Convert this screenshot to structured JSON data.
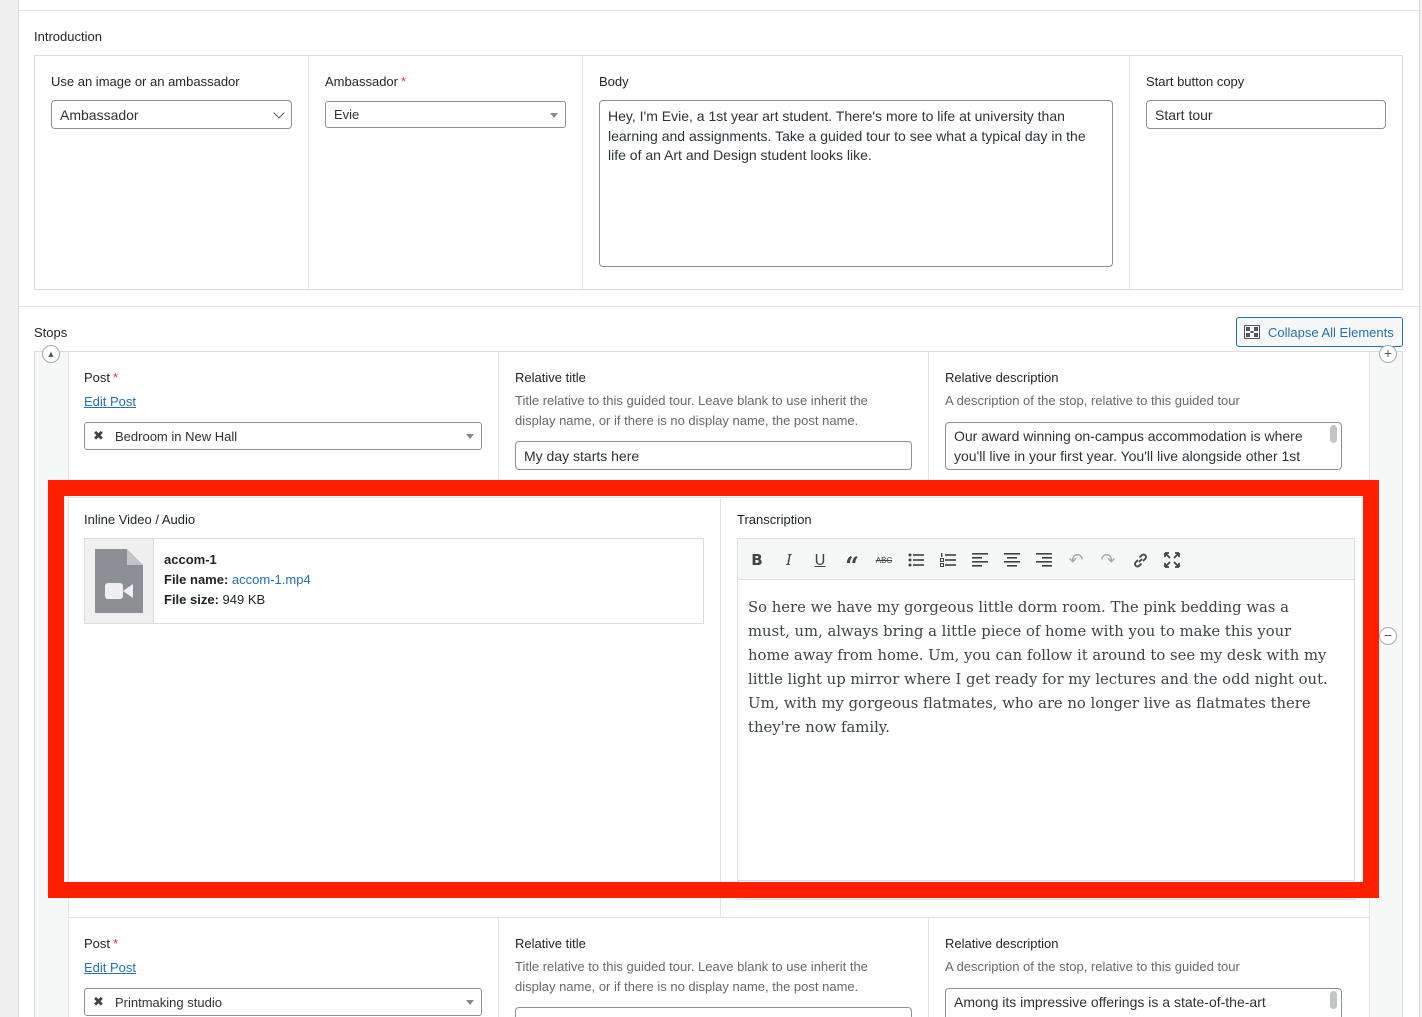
{
  "introduction": {
    "section_label": "Introduction",
    "image_or_ambassador": {
      "label": "Use an image or an ambassador",
      "value": "Ambassador"
    },
    "ambassador": {
      "label": "Ambassador",
      "required": "*",
      "value": "Evie"
    },
    "body": {
      "label": "Body",
      "value": "Hey, I'm Evie, a 1st year art student. There's more to life at university than learning and assignments. Take a guided tour to see what a typical day in the life of an Art and Design student looks like."
    },
    "start_button": {
      "label": "Start button copy",
      "value": "Start tour"
    }
  },
  "stops": {
    "section_label": "Stops",
    "collapse_button": "Collapse All Elements",
    "items": [
      {
        "post_label": "Post",
        "required": "*",
        "edit_link": "Edit Post",
        "post_value": "Bedroom in New Hall",
        "relative_title_label": "Relative title",
        "relative_title_help": "Title relative to this guided tour. Leave blank to use inherit the display name, or if there is no display name, the post name.",
        "relative_title_value": "My day starts here",
        "relative_description_label": "Relative description",
        "relative_description_help": "A description of the stop, relative to this guided tour",
        "relative_description_value": "Our award winning on-campus accommodation is where you'll live in your first year. You'll live alongside other 1st",
        "media_label": "Inline Video / Audio",
        "media_title": "accom-1",
        "file_name_label": "File name:",
        "file_name_value": "accom-1.mp4",
        "file_size_label": "File size:",
        "file_size_value": "949 KB",
        "transcription_label": "Transcription",
        "transcription_text": "So here we have my gorgeous little dorm room. The pink bedding was a must, um, always bring a little piece of home with you to make this your home away from home. Um, you can follow it around to see my desk with my little light up mirror where I get ready for my lectures and the odd night out. Um, with my gorgeous flatmates, who are no longer live as flatmates there they're now family."
      },
      {
        "post_label": "Post",
        "required": "*",
        "edit_link": "Edit Post",
        "post_value": "Printmaking studio",
        "relative_title_label": "Relative title",
        "relative_title_help": "Title relative to this guided tour. Leave blank to use inherit the display name, or if there is no display name, the post name.",
        "relative_description_label": "Relative description",
        "relative_description_help": "A description of the stop, relative to this guided tour",
        "relative_description_value": "Among its impressive offerings is a state-of-the-art"
      }
    ]
  },
  "toolbar_icons": [
    "bold-icon",
    "italic-icon",
    "underline-icon",
    "blockquote-icon",
    "strikethrough-icon",
    "bullet-list-icon",
    "numbered-list-icon",
    "align-left-icon",
    "align-center-icon",
    "align-right-icon",
    "undo-icon",
    "redo-icon",
    "link-icon",
    "fullscreen-icon"
  ],
  "colors": {
    "highlight": "#ff1e00",
    "link": "#2271b1",
    "required": "#d63638"
  }
}
